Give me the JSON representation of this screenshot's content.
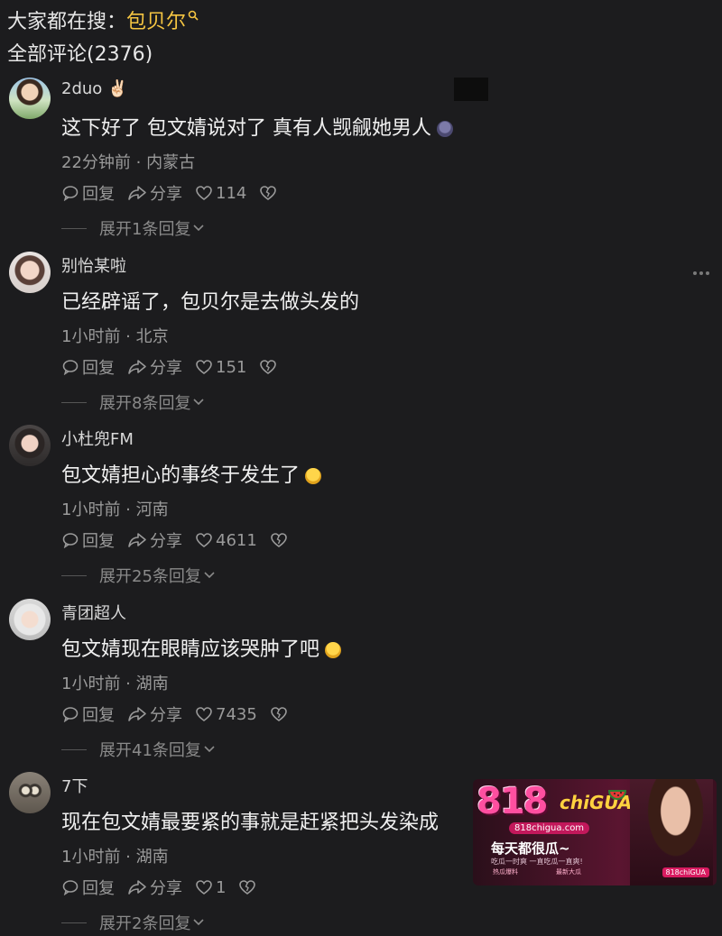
{
  "search": {
    "prefix": "大家都在搜：",
    "keyword": "包贝尔",
    "icon": "search-icon",
    "keyword_color": "#f5c542"
  },
  "comments_header": {
    "label": "全部评论(2376)"
  },
  "comments": [
    {
      "username": "2duo",
      "username_emoji": "✌🏻",
      "content": "这下好了 包文婧说对了 真有人觊觎她男人",
      "emoji": "face-emoji",
      "meta": "22分钟前 · 内蒙古",
      "reply_label": "回复",
      "share_label": "分享",
      "likes": "114",
      "expand_label": "展开1条回复"
    },
    {
      "username": "别怡某啦",
      "username_emoji": "",
      "content": "已经辟谣了，包贝尔是去做头发的",
      "emoji": "",
      "meta": "1小时前 · 北京",
      "reply_label": "回复",
      "share_label": "分享",
      "likes": "151",
      "expand_label": "展开8条回复"
    },
    {
      "username": "小杜兜FM",
      "username_emoji": "",
      "content": "包文婧担心的事终于发生了",
      "emoji": "worried-emoji",
      "meta": "1小时前 · 河南",
      "reply_label": "回复",
      "share_label": "分享",
      "likes": "4611",
      "expand_label": "展开25条回复"
    },
    {
      "username": "青团超人",
      "username_emoji": "",
      "content": "包文婧现在眼睛应该哭肿了吧",
      "emoji": "crying-emoji",
      "meta": "1小时前 · 湖南",
      "reply_label": "回复",
      "share_label": "分享",
      "likes": "7435",
      "expand_label": "展开41条回复"
    },
    {
      "username": "7下",
      "username_emoji": "",
      "content": "现在包文婧最要紧的事就是赶紧把头发染成",
      "emoji": "",
      "meta": "1小时前 · 湖南",
      "reply_label": "回复",
      "share_label": "分享",
      "likes": "1",
      "expand_label": "展开2条回复"
    }
  ],
  "ad": {
    "logo": "818",
    "logo_suffix": "chiGUA",
    "url": "818chigua.com",
    "slogan": "每天都很瓜~",
    "subtitle": "吃瓜一时爽 一直吃瓜一直爽!",
    "chip_left": "热瓜爆料",
    "chip_right": "最新大瓜",
    "badge": "818chiGUA",
    "accent_color": "#ff4fa0"
  }
}
